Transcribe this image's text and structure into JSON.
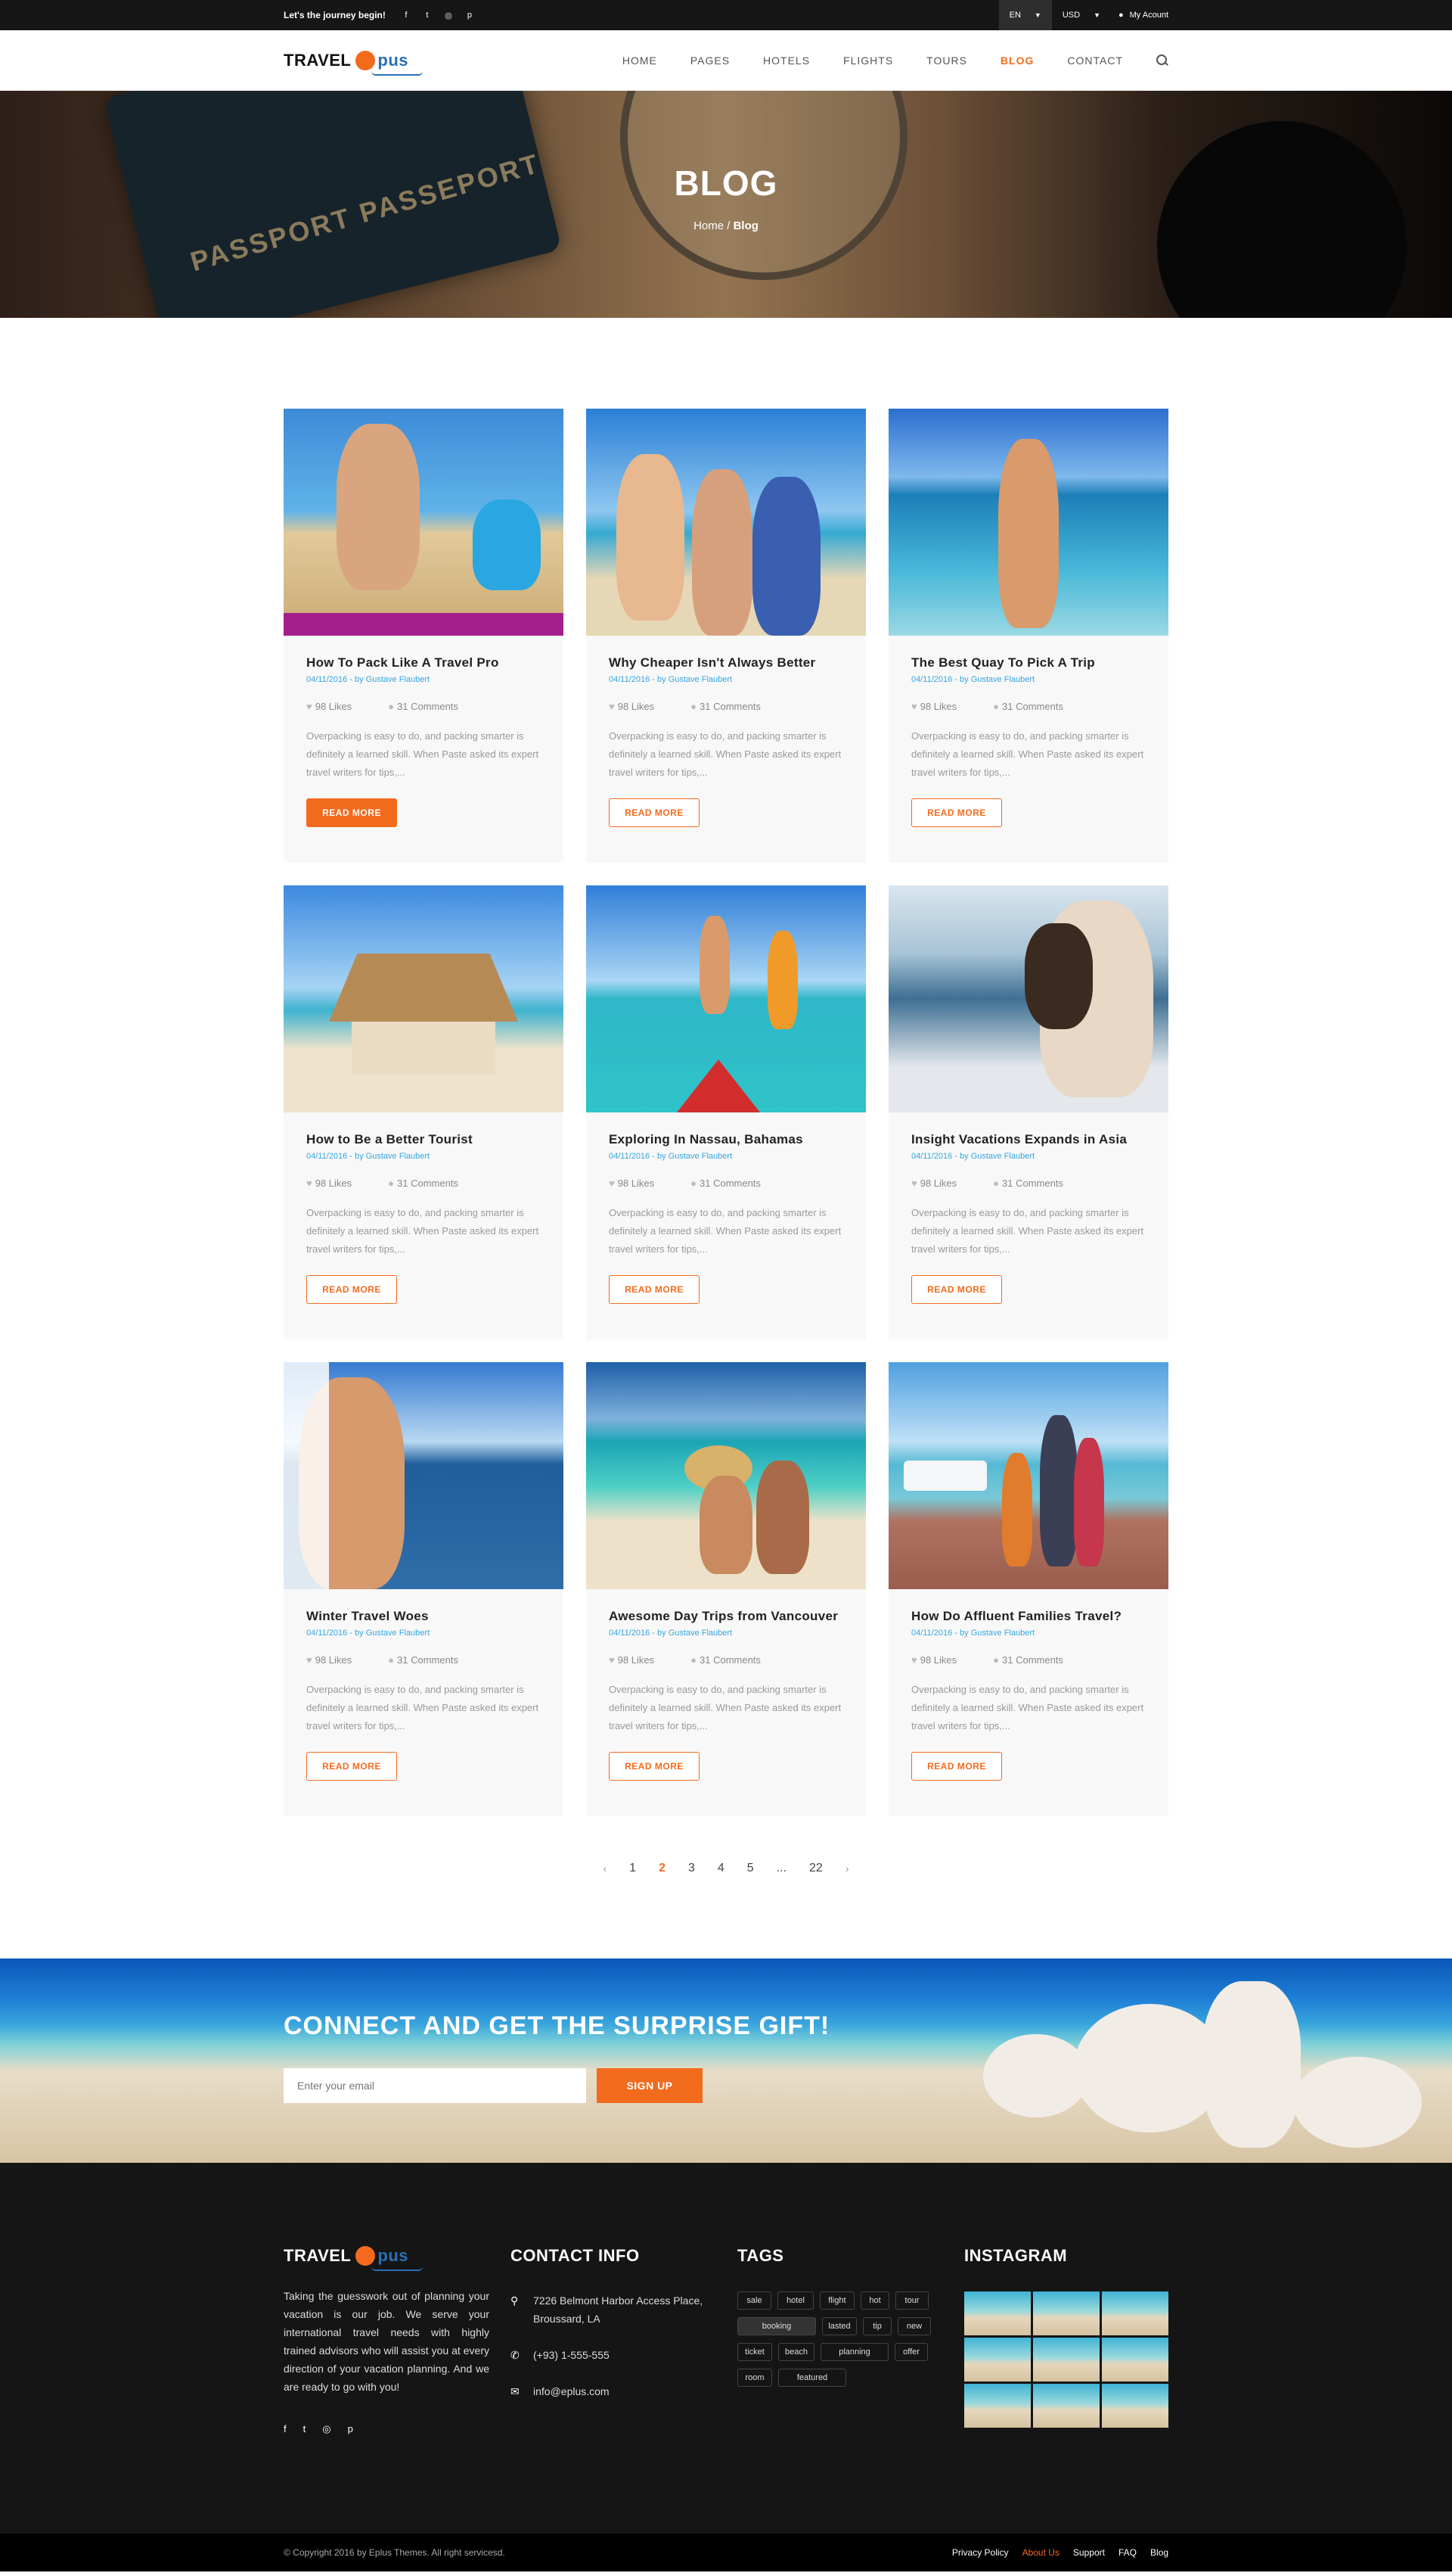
{
  "topbar": {
    "tagline": "Let's the journey begin!",
    "social": [
      {
        "icon": "facebook-icon",
        "glyph": "f"
      },
      {
        "icon": "twitter-icon",
        "glyph": "t"
      },
      {
        "icon": "instagram-icon",
        "glyph": "◎"
      },
      {
        "icon": "pinterest-icon",
        "glyph": "p"
      }
    ],
    "language": "EN",
    "currency": "USD",
    "account": "My Acount"
  },
  "header": {
    "logo_text": "TRAVEL",
    "logo_suffix": "pus",
    "nav": [
      "HOME",
      "PAGES",
      "HOTELS",
      "FLIGHTS",
      "TOURS",
      "BLOG",
      "CONTACT"
    ],
    "active": "BLOG"
  },
  "hero": {
    "title": "BLOG",
    "breadcrumb_home": "Home",
    "breadcrumb_sep": "/",
    "breadcrumb_current": "Blog",
    "passport_text": "PASSPORT PASSEPORT"
  },
  "posts": [
    {
      "title": "How To Pack Like A Travel Pro",
      "date": "04/11/2016",
      "by": "by Gustave Flaubert",
      "likes": "98 Likes",
      "comments": "31 Comments",
      "excerpt": "Overpacking is easy to do, and packing smarter is definitely a learned skill. When Paste asked its expert travel writers for tips,...",
      "button": "READ MORE"
    },
    {
      "title": "Why Cheaper Isn't Always Better",
      "date": "04/11/2016",
      "by": "by Gustave Flaubert",
      "likes": "98 Likes",
      "comments": "31 Comments",
      "excerpt": "Overpacking is easy to do, and packing smarter is definitely a learned skill. When Paste asked its expert travel writers for tips,...",
      "button": "READ MORE"
    },
    {
      "title": "The Best Quay To Pick A Trip",
      "date": "04/11/2016",
      "by": "by Gustave Flaubert",
      "likes": "98 Likes",
      "comments": "31 Comments",
      "excerpt": "Overpacking is easy to do, and packing smarter is definitely a learned skill. When Paste asked its expert travel writers for tips,...",
      "button": "READ MORE"
    },
    {
      "title": "How to Be a Better Tourist",
      "date": "04/11/2016",
      "by": "by Gustave Flaubert",
      "likes": "98 Likes",
      "comments": "31 Comments",
      "excerpt": "Overpacking is easy to do, and packing smarter is definitely a learned skill. When Paste asked its expert travel writers for tips,...",
      "button": "READ MORE"
    },
    {
      "title": "Exploring In Nassau, Bahamas",
      "date": "04/11/2016",
      "by": "by Gustave Flaubert",
      "likes": "98 Likes",
      "comments": "31 Comments",
      "excerpt": "Overpacking is easy to do, and packing smarter is definitely a learned skill. When Paste asked its expert travel writers for tips,...",
      "button": "READ MORE"
    },
    {
      "title": "Insight Vacations Expands in Asia",
      "date": "04/11/2016",
      "by": "by Gustave Flaubert",
      "likes": "98 Likes",
      "comments": "31 Comments",
      "excerpt": "Overpacking is easy to do, and packing smarter is definitely a learned skill. When Paste asked its expert travel writers for tips,...",
      "button": "READ MORE"
    },
    {
      "title": "Winter Travel Woes",
      "date": "04/11/2016",
      "by": "by Gustave Flaubert",
      "likes": "98 Likes",
      "comments": "31 Comments",
      "excerpt": "Overpacking is easy to do, and packing smarter is definitely a learned skill. When Paste asked its expert travel writers for tips,...",
      "button": "READ MORE"
    },
    {
      "title": "Awesome Day Trips from Vancouver",
      "date": "04/11/2016",
      "by": "by Gustave Flaubert",
      "likes": "98 Likes",
      "comments": "31 Comments",
      "excerpt": "Overpacking is easy to do, and packing smarter is definitely a learned skill. When Paste asked its expert travel writers for tips,...",
      "button": "READ MORE"
    },
    {
      "title": "How Do Affluent Families Travel?",
      "date": "04/11/2016",
      "by": "by Gustave Flaubert",
      "likes": "98 Likes",
      "comments": "31 Comments",
      "excerpt": "Overpacking is easy to do, and packing smarter is definitely a learned skill. When Paste asked its expert travel writers for tips,...",
      "button": "READ MORE"
    }
  ],
  "pagination": {
    "prev": "‹",
    "pages": [
      "1",
      "2",
      "3",
      "4",
      "5",
      "...",
      "22"
    ],
    "current": "2",
    "next": "›"
  },
  "newsletter": {
    "title": "CONNECT AND GET THE SURPRISE GIFT!",
    "placeholder": "Enter your email",
    "button": "SIGN UP"
  },
  "footer": {
    "logo_text": "TRAVEL",
    "logo_suffix": "pus",
    "about": "Taking the guesswork out of planning your vacation is our job. We serve your international travel needs with highly trained advisors who will assist you at every direction of your vacation planning. And we are ready to go with you!",
    "social": [
      "facebook-icon",
      "twitter-icon",
      "instagram-icon",
      "pinterest-icon"
    ],
    "contact_title": "CONTACT INFO",
    "address": "7226 Belmont Harbor Access Place, Broussard, LA",
    "phone": "(+93) 1-555-555",
    "email": "info@eplus.com",
    "tags_title": "TAGS",
    "tags": [
      "sale",
      "hotel",
      "flight",
      "hot",
      "tour",
      "booking",
      "lasted",
      "tip",
      "new",
      "ticket",
      "beach",
      "planning",
      "offer",
      "room",
      "featured"
    ],
    "instagram_title": "INSTAGRAM",
    "copyright": "© Copyright 2016 by Eplus Themes. All right servicesd.",
    "links": [
      "Privacy Policy",
      "About Us",
      "Support",
      "FAQ",
      "Blog"
    ],
    "links_active": "About Us"
  },
  "colors": {
    "accent": "#f26b1d",
    "link": "#36a6e0",
    "dark": "#151515"
  }
}
